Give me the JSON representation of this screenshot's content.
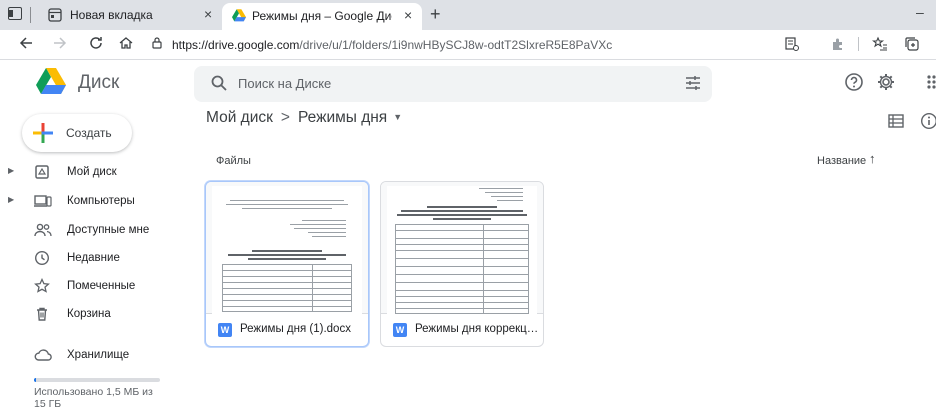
{
  "browser": {
    "tabs": [
      {
        "title": "Новая вкладка",
        "active": false
      },
      {
        "title": "Режимы дня – Google Диск",
        "active": true
      }
    ],
    "tab_close": "×",
    "new_tab": "+",
    "minimize": "–",
    "url_host": "https://drive.google.com",
    "url_path": "/drive/u/1/folders/1i9nwHBySCJ8w-odtT2SlxreR5E8PaVXc"
  },
  "header": {
    "app_title": "Диск",
    "search_placeholder": "Поиск на Диске"
  },
  "sidebar": {
    "create_label": "Создать",
    "items": [
      {
        "label": "Мой диск",
        "icon": "drive-icon",
        "expandable": true
      },
      {
        "label": "Компьютеры",
        "icon": "computer-icon",
        "expandable": true
      },
      {
        "label": "Доступные мне",
        "icon": "shared-icon",
        "expandable": false
      },
      {
        "label": "Недавние",
        "icon": "clock-icon",
        "expandable": false
      },
      {
        "label": "Помеченные",
        "icon": "star-icon",
        "expandable": false
      },
      {
        "label": "Корзина",
        "icon": "trash-icon",
        "expandable": false
      },
      {
        "label": "Хранилище",
        "icon": "cloud-icon",
        "expandable": false
      }
    ],
    "storage_text": "Использовано 1,5 МБ из 15 ГБ",
    "storage_fraction": 0.0001
  },
  "main": {
    "breadcrumb": [
      "Мой диск",
      "Режимы дня"
    ],
    "breadcrumb_sep": ">",
    "section_title": "Файлы",
    "sort_label": "Название",
    "sort_arrow": "↑",
    "files": [
      {
        "name": "Режимы дня (1).docx",
        "type_badge": "W",
        "selected": true
      },
      {
        "name": "Режимы дня коррекционной группы.docx",
        "type_badge": "W",
        "selected": false
      }
    ]
  },
  "colors": {
    "accent": "#1a73e8",
    "doc_blue": "#4285f4",
    "tab_strip": "#dee1e6",
    "search_bg": "#f1f3f4"
  }
}
